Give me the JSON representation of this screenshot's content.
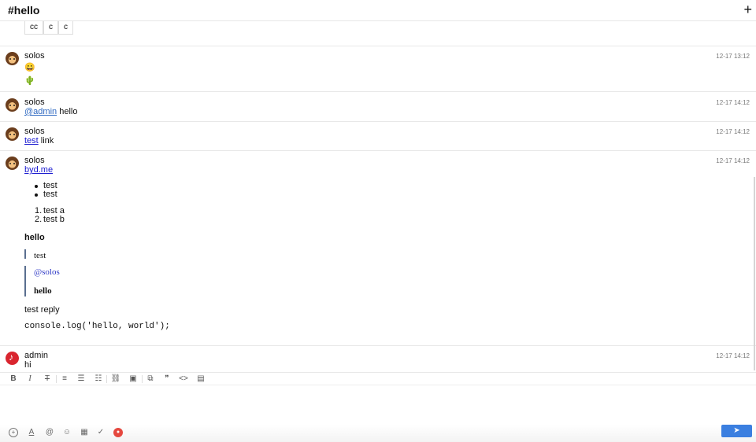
{
  "header": {
    "title": "#hello",
    "add_icon": "+"
  },
  "table_fragment": [
    "cc",
    "c",
    "c"
  ],
  "messages": [
    {
      "user": "solos",
      "time": "12-17 13:12",
      "emoji1": "😀",
      "emoji2": "🌵"
    },
    {
      "user": "solos",
      "time": "12-17 14:12",
      "mention": "@admin",
      "text": "hello"
    },
    {
      "user": "solos",
      "time": "12-17 14:12",
      "link": "test",
      "text": "link"
    },
    {
      "user": "solos",
      "time": "12-17 14:12",
      "link": "byd.me",
      "bullets": [
        "test",
        "test"
      ],
      "ordered_numbers": [
        "1.",
        "2."
      ],
      "ordered": [
        "test a",
        "test b"
      ],
      "bold_heading": "hello",
      "quote1": "test",
      "quote2_mention": "@solos",
      "quote2_bold": "hello",
      "reply": "test reply",
      "code": "console.log('hello, world');"
    },
    {
      "user": "admin",
      "time": "12-17 14:12",
      "text": "hi"
    }
  ],
  "toolbar": {
    "bold": "B",
    "italic": "I",
    "strike": "T",
    "align": "≡",
    "bullet_list": "☰",
    "ordered_list": "☷",
    "link": "⛓",
    "image": "▣",
    "copy": "⧉",
    "quote": "❞",
    "code": "<>",
    "table": "▤"
  },
  "bottom": {
    "plus": "+",
    "font": "A",
    "at": "@",
    "emoji": "☺",
    "calendar": "▦",
    "task": "✓",
    "record": "●",
    "send": "➤"
  },
  "colors": {
    "accent": "#3b7fe0",
    "mention": "#2f69c1",
    "record": "#e5483f"
  }
}
